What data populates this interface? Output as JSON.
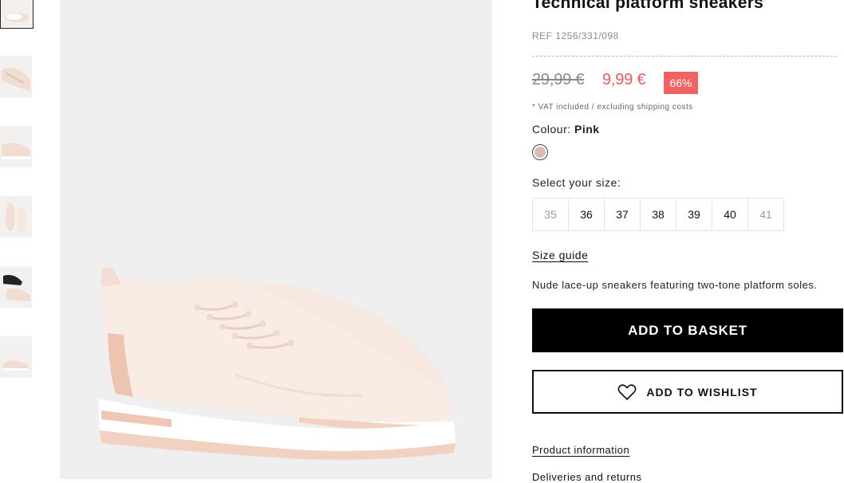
{
  "thumbnails": [
    {
      "label": "thumbnail-1",
      "variant": "pair"
    },
    {
      "label": "thumbnail-2",
      "variant": "top"
    },
    {
      "label": "thumbnail-3",
      "variant": "side"
    },
    {
      "label": "thumbnail-4",
      "variant": "sole"
    },
    {
      "label": "thumbnail-5",
      "variant": "styled"
    },
    {
      "label": "thumbnail-6",
      "variant": "single"
    }
  ],
  "product": {
    "title": "Technical platform sneakers",
    "ref": "REF 1256/331/098",
    "old_price": "29,99 €",
    "new_price": "9,99 €",
    "discount": "66%",
    "vat_note": "* VAT included / excluding shipping costs",
    "colour_label": "Colour:",
    "colour_value": "Pink",
    "swatch_color": "#d9bdb3",
    "size_label": "Select your size:",
    "sizes": [
      {
        "value": "35",
        "available": false
      },
      {
        "value": "36",
        "available": true
      },
      {
        "value": "37",
        "available": true
      },
      {
        "value": "38",
        "available": true
      },
      {
        "value": "39",
        "available": true
      },
      {
        "value": "40",
        "available": true
      },
      {
        "value": "41",
        "available": false
      }
    ],
    "size_guide": "Size guide",
    "description": "Nude lace-up sneakers featuring two-tone platform soles.",
    "add_to_basket": "ADD TO BASKET",
    "add_to_wishlist": "ADD TO WISHLIST",
    "product_information": "Product information",
    "deliveries_returns": "Deliveries and returns"
  },
  "colors": {
    "sale": "#ee5a5a",
    "badge": "#f26262",
    "primary_button": "#000000",
    "image_background": "#efefef"
  }
}
